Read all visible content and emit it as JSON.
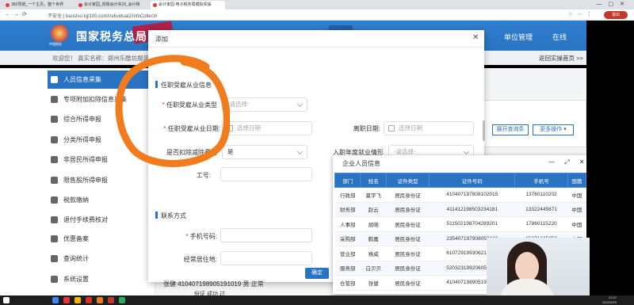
{
  "browser": {
    "tabs": [
      "360导航_一个主页，整个世界",
      "会计家园_财税会计实训_会计移",
      "会计家园-电子税务局模拟实操"
    ],
    "address": "不安全 | baoshui.kjjl100.com/individual2/infoCollect#",
    "user_pill": "退出"
  },
  "header": {
    "site_title": "国家税务总局",
    "emblem_caption": "中国税务",
    "unit_management": "单位管理",
    "online": "在线"
  },
  "welcome": {
    "text": "欢迎您！ 真实名称：郑州乐酷坊服装",
    "back_home": "返回实操首页 >>"
  },
  "sidebar": {
    "items": [
      {
        "label": "人员信息采集",
        "active": true
      },
      {
        "label": "专项附加扣除信息采集"
      },
      {
        "label": "综合所得申报"
      },
      {
        "label": "分类所得申报"
      },
      {
        "label": "非居民所得申报"
      },
      {
        "label": "限售股所得申报"
      },
      {
        "label": "税款缴纳"
      },
      {
        "label": "退付手续费核对"
      },
      {
        "label": "优惠备案"
      },
      {
        "label": "查询统计"
      },
      {
        "label": "系统设置"
      }
    ]
  },
  "main": {
    "query_config": "展开查询条",
    "more_ops": "更多操作 ▾",
    "bottom_row": "张健  410407198905191019  男  正常",
    "bottom_row2": "份证                          成功      过"
  },
  "dialog": {
    "title": "添加",
    "section1": "任职受雇从业信息",
    "employment_type_label": "任职受雇从业类型",
    "employment_type_placeholder": "-请选择-",
    "employment_date_label": "任职受雇从业日期:",
    "employment_date_placeholder": "选择日期",
    "leave_date_label": "离职日期:",
    "leave_date_placeholder": "选择日期",
    "deduct_fee_label": "是否扣除减除费用",
    "deduct_fee_value": "是",
    "first_year_label": "入职年度就业情形",
    "first_year_placeholder": "-请选择-",
    "employee_no_label": "工号:",
    "section2": "联系方式",
    "phone_label": "手机号码:",
    "address_label": "经常居住地:",
    "confirm": "确定"
  },
  "employee_window": {
    "title": "企业人员信息",
    "controls": "— ⤢ ✕",
    "columns": [
      "部门",
      "姓名",
      "证件类型",
      "证件号码",
      "手机号",
      "国籍"
    ],
    "rows": [
      [
        "行政部",
        "夏宇飞",
        "居民身份证",
        "410407197808102015",
        "13760110202",
        "中国"
      ],
      [
        "财务部",
        "赵云",
        "居民身份证",
        "411412198503234181",
        "13322445671",
        "中国"
      ],
      [
        "人事部",
        "胡晓",
        "居民身份证",
        "511502198704289201",
        "17860115220",
        "中国"
      ],
      [
        "采购部",
        "鹤嘉",
        "居民身份证",
        "235407197908059120",
        "15871245850",
        "中国"
      ],
      [
        "营业部",
        "杨威",
        "居民身份证",
        "610729199306212231",
        "",
        "中国"
      ],
      [
        "服务部",
        "白贝贝",
        "居民身份证",
        "520323199206058887",
        "",
        "中国"
      ],
      [
        "仓管部",
        "张健",
        "居民身份证",
        "410407198905191019",
        "",
        "中国"
      ]
    ]
  },
  "taskbar": {
    "time": "21:07",
    "date": "2022/5/23"
  },
  "colors": {
    "primary": "#2a73c2",
    "annotation": "#f07c1e",
    "required": "#e4393c"
  }
}
